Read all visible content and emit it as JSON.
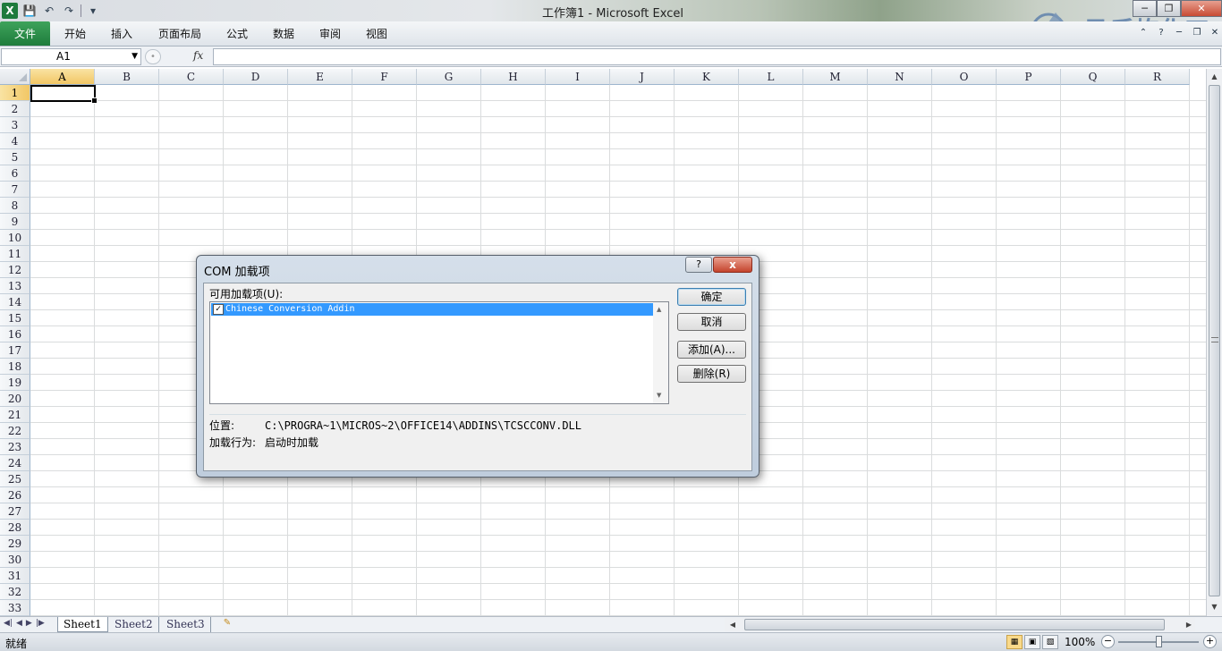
{
  "window": {
    "title": "工作簿1 - Microsoft Excel",
    "app_icon": "X"
  },
  "watermark": {
    "line1": "马后炮化工",
    "line2": "MAHOUPAO"
  },
  "ribbon": {
    "file_label": "文件",
    "tabs": [
      "开始",
      "插入",
      "页面布局",
      "公式",
      "数据",
      "审阅",
      "视图"
    ]
  },
  "formula_bar": {
    "name_box": "A1",
    "fx": "fx",
    "formula": ""
  },
  "grid": {
    "columns": [
      "A",
      "B",
      "C",
      "D",
      "E",
      "F",
      "G",
      "H",
      "I",
      "J",
      "K",
      "L",
      "M",
      "N",
      "O",
      "P",
      "Q",
      "R"
    ],
    "rows": [
      "1",
      "2",
      "3",
      "4",
      "5",
      "6",
      "7",
      "8",
      "9",
      "10",
      "11",
      "12",
      "13",
      "14",
      "15",
      "16",
      "17",
      "18",
      "19",
      "20",
      "21",
      "22",
      "23",
      "24",
      "25",
      "26",
      "27",
      "28",
      "29",
      "30",
      "31",
      "32",
      "33"
    ],
    "active_cell": "A1"
  },
  "sheets": {
    "tabs": [
      "Sheet1",
      "Sheet2",
      "Sheet3"
    ],
    "active": "Sheet1"
  },
  "status": {
    "ready": "就绪",
    "zoom": "100%"
  },
  "dialog": {
    "title": "COM 加载项",
    "help": "?",
    "close": "x",
    "available_label": "可用加载项(U):",
    "addins": [
      {
        "name": "Chinese Conversion Addin",
        "checked": true
      }
    ],
    "buttons": {
      "ok": "确定",
      "cancel": "取消",
      "add": "添加(A)...",
      "remove": "删除(R)"
    },
    "location_label": "位置:",
    "location_value": "C:\\PROGRA~1\\MICROS~2\\OFFICE14\\ADDINS\\TCSCCONV.DLL",
    "behavior_label": "加载行为:",
    "behavior_value": "启动时加载"
  },
  "colors": {
    "file_tab": "#1e7c3c",
    "selected_header": "#f2c765",
    "selection_blue": "#3399ff"
  }
}
